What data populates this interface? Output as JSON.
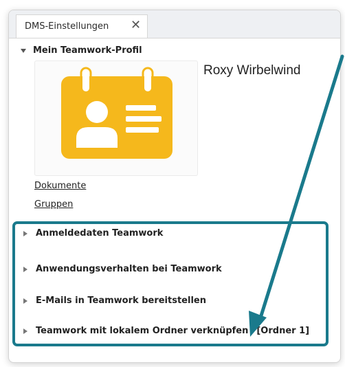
{
  "tab": {
    "title": "DMS-Einstellungen",
    "close_label": "✕"
  },
  "profile": {
    "section_title": "Mein Teamwork-Profil",
    "user_name": "Roxy Wirbelwind",
    "links": [
      "Dokumente",
      "Gruppen"
    ]
  },
  "sections": [
    {
      "label": "Anmeldedaten Teamwork"
    },
    {
      "label": "Anwendungsverhalten bei Teamwork"
    },
    {
      "label": "E-Mails in Teamwork bereitstellen"
    },
    {
      "label": "Teamwork mit lokalem Ordner verknüpfen",
      "tag": "[Ordner 1]"
    }
  ],
  "colors": {
    "accent": "#1a7a8c",
    "badge": "#f5b81c"
  },
  "icons": {
    "badge": "id-badge-icon",
    "expand": "triangle-down-icon",
    "collapsed": "triangle-right-icon"
  }
}
